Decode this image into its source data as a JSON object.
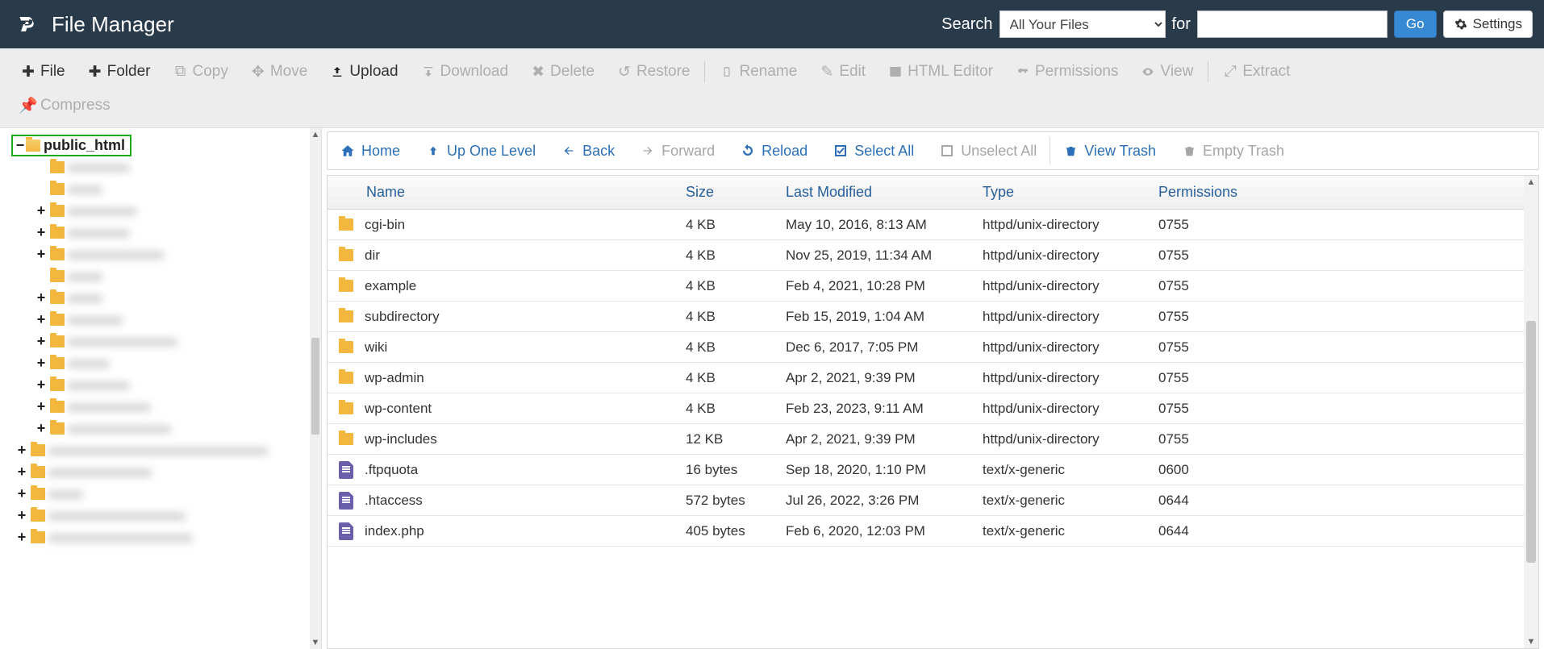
{
  "header": {
    "title": "File Manager",
    "search_label": "Search",
    "for_label": "for",
    "search_select": "All Your Files",
    "go_label": "Go",
    "settings_label": "Settings"
  },
  "toolbar": {
    "file": "File",
    "folder": "Folder",
    "copy": "Copy",
    "move": "Move",
    "upload": "Upload",
    "download": "Download",
    "delete": "Delete",
    "restore": "Restore",
    "rename": "Rename",
    "edit": "Edit",
    "html_editor": "HTML Editor",
    "permissions": "Permissions",
    "view": "View",
    "extract": "Extract",
    "compress": "Compress"
  },
  "tree": {
    "root": "public_html"
  },
  "actionbar": {
    "home": "Home",
    "up": "Up One Level",
    "back": "Back",
    "forward": "Forward",
    "reload": "Reload",
    "select_all": "Select All",
    "unselect_all": "Unselect All",
    "view_trash": "View Trash",
    "empty_trash": "Empty Trash"
  },
  "columns": {
    "name": "Name",
    "size": "Size",
    "modified": "Last Modified",
    "type": "Type",
    "perm": "Permissions"
  },
  "rows": [
    {
      "icon": "folder",
      "name": "cgi-bin",
      "size": "4 KB",
      "modified": "May 10, 2016, 8:13 AM",
      "type": "httpd/unix-directory",
      "perm": "0755"
    },
    {
      "icon": "folder",
      "name": "dir",
      "size": "4 KB",
      "modified": "Nov 25, 2019, 11:34 AM",
      "type": "httpd/unix-directory",
      "perm": "0755"
    },
    {
      "icon": "folder",
      "name": "example",
      "size": "4 KB",
      "modified": "Feb 4, 2021, 10:28 PM",
      "type": "httpd/unix-directory",
      "perm": "0755"
    },
    {
      "icon": "folder",
      "name": "subdirectory",
      "size": "4 KB",
      "modified": "Feb 15, 2019, 1:04 AM",
      "type": "httpd/unix-directory",
      "perm": "0755"
    },
    {
      "icon": "folder",
      "name": "wiki",
      "size": "4 KB",
      "modified": "Dec 6, 2017, 7:05 PM",
      "type": "httpd/unix-directory",
      "perm": "0755"
    },
    {
      "icon": "folder",
      "name": "wp-admin",
      "size": "4 KB",
      "modified": "Apr 2, 2021, 9:39 PM",
      "type": "httpd/unix-directory",
      "perm": "0755"
    },
    {
      "icon": "folder",
      "name": "wp-content",
      "size": "4 KB",
      "modified": "Feb 23, 2023, 9:11 AM",
      "type": "httpd/unix-directory",
      "perm": "0755"
    },
    {
      "icon": "folder",
      "name": "wp-includes",
      "size": "12 KB",
      "modified": "Apr 2, 2021, 9:39 PM",
      "type": "httpd/unix-directory",
      "perm": "0755"
    },
    {
      "icon": "file",
      "name": ".ftpquota",
      "size": "16 bytes",
      "modified": "Sep 18, 2020, 1:10 PM",
      "type": "text/x-generic",
      "perm": "0600"
    },
    {
      "icon": "file",
      "name": ".htaccess",
      "size": "572 bytes",
      "modified": "Jul 26, 2022, 3:26 PM",
      "type": "text/x-generic",
      "perm": "0644"
    },
    {
      "icon": "file",
      "name": "index.php",
      "size": "405 bytes",
      "modified": "Feb 6, 2020, 12:03 PM",
      "type": "text/x-generic",
      "perm": "0644"
    }
  ]
}
